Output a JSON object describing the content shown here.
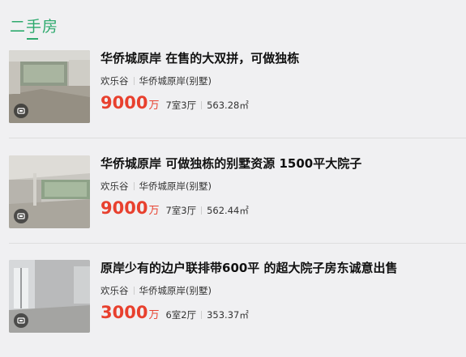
{
  "section": {
    "title": "二手房"
  },
  "listings": [
    {
      "title": "华侨城原岸 在售的大双拼，可做独栋",
      "district": "欢乐谷",
      "community": "华侨城原岸(别墅)",
      "price": "9000",
      "price_unit": "万",
      "layout": "7室3厅",
      "area": "563.28㎡",
      "media_icon": "video-icon"
    },
    {
      "title": "华侨城原岸 可做独栋的别墅资源 1500平大院子",
      "district": "欢乐谷",
      "community": "华侨城原岸(别墅)",
      "price": "9000",
      "price_unit": "万",
      "layout": "7室3厅",
      "area": "562.44㎡",
      "media_icon": "video-icon"
    },
    {
      "title": "原岸少有的边户联排带600平 的超大院子房东诚意出售",
      "district": "欢乐谷",
      "community": "华侨城原岸(别墅)",
      "price": "3000",
      "price_unit": "万",
      "layout": "6室2厅",
      "area": "353.37㎡",
      "media_icon": "video-icon"
    }
  ],
  "colors": {
    "accent": "#2eaa6e",
    "price": "#e8402e"
  }
}
